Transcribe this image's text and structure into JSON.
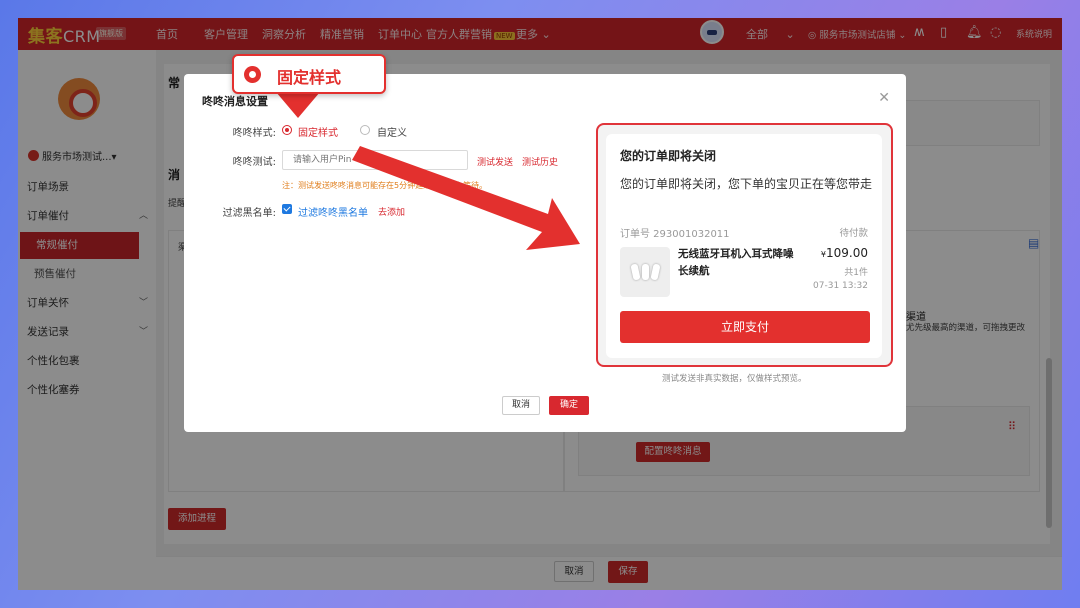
{
  "topnav": {
    "logo_main": "集客",
    "logo_crm": "CRM",
    "logo_badge": "旗舰版",
    "items": [
      "首页",
      "客户管理",
      "洞察分析",
      "精准营销",
      "订单中心",
      "官方人群营销",
      "更多"
    ],
    "new_badge": "NEW",
    "scope": "全部",
    "store": "服务市场测试店铺",
    "help": "系统说明"
  },
  "sidebar": {
    "shop_name": "服务市场测试...▾",
    "items": [
      {
        "label": "订单场景"
      },
      {
        "label": "订单催付"
      },
      {
        "label": "常规催付"
      },
      {
        "label": "预售催付"
      },
      {
        "label": "订单关怀"
      },
      {
        "label": "发送记录"
      },
      {
        "label": "个性化包裹"
      },
      {
        "label": "个性化塞券"
      }
    ]
  },
  "background": {
    "section1_title": "常",
    "section2_title": "消",
    "hint_prefix": "提醒",
    "tab_stub": "渠",
    "channel_title": "渠道",
    "channel_desc": "尤先级最高的渠道，可拖拽更改",
    "config_btn": "配置咚咚消息",
    "add_process_btn": "添加进程",
    "cancel_btn": "取消",
    "save_btn": "保存"
  },
  "modal": {
    "title": "咚咚消息设置",
    "style_label": "咚咚样式:",
    "style_fixed": "固定样式",
    "style_custom": "自定义",
    "test_label": "咚咚测试:",
    "test_placeholder": "请输入用户Pin",
    "test_send": "测试发送",
    "test_history": "测试历史",
    "note": "注：测试发送咚咚消息可能存在5分钟延迟，请耐心等待。",
    "blacklist_label": "过滤黑名单:",
    "blacklist_check": "过滤咚咚黑名单",
    "blacklist_add": "去添加",
    "preview_hint": "测试发送非真实数据，仅做样式预览。",
    "cancel": "取消",
    "confirm": "确定"
  },
  "preview": {
    "title": "您的订单即将关闭",
    "message": "您的订单即将关闭，您下单的宝贝正在等您带走",
    "order_no": "订单号 293001032011",
    "status": "待付款",
    "product_name": "无线蓝牙耳机入耳式降噪长续航",
    "currency": "¥",
    "price": "109.00",
    "count": "共1件",
    "time": "07-31 13:32",
    "pay_btn": "立即支付"
  },
  "callout": {
    "text": "固定样式"
  },
  "colors": {
    "brand_red": "#d4262b",
    "accent_red": "#e3302e",
    "link_blue": "#1e79e0",
    "note_orange": "#e07e1c"
  }
}
